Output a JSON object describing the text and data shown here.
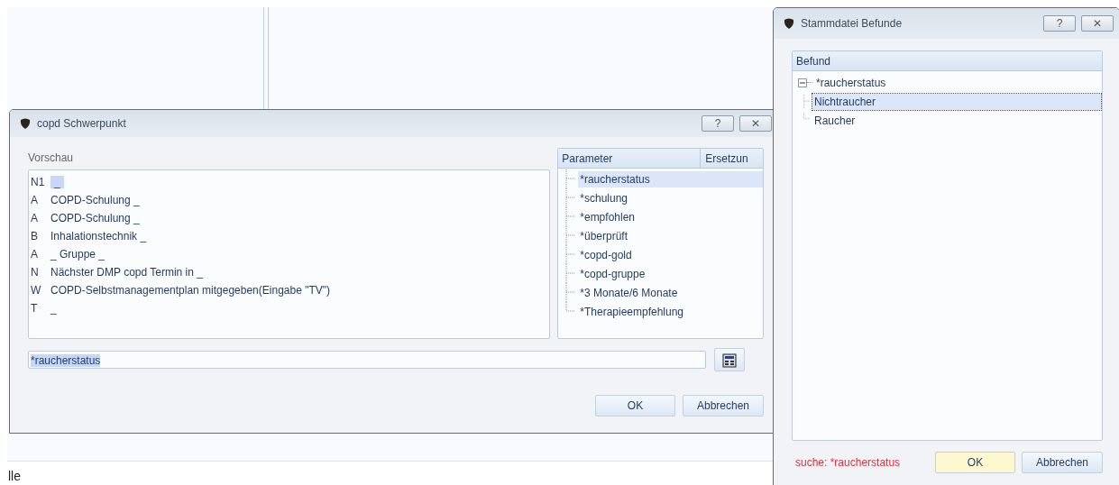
{
  "background": {
    "footer_text": "lle"
  },
  "preview_dialog": {
    "title": "copd Schwerpunkt",
    "help": "?",
    "close": "✕",
    "preview_label": "Vorschau",
    "lines": [
      {
        "code": "N1",
        "text": "_",
        "highlighted": true
      },
      {
        "code": "A",
        "text": "COPD-Schulung _",
        "highlighted": false
      },
      {
        "code": "A",
        "text": "COPD-Schulung _",
        "highlighted": false
      },
      {
        "code": "B",
        "text": "Inhalationstechnik _",
        "highlighted": false
      },
      {
        "code": "A",
        "text": "_ Gruppe _",
        "highlighted": false
      },
      {
        "code": "N",
        "text": "Nächster DMP copd Termin in _",
        "highlighted": false
      },
      {
        "code": "W",
        "text": "COPD-Selbstmanagementplan mitgegeben(Eingabe \"TV\")",
        "highlighted": false
      },
      {
        "code": "T",
        "text": "_",
        "highlighted": false
      }
    ],
    "parameter_columns": [
      "Parameter",
      "Ersetzun"
    ],
    "parameters": [
      {
        "label": "*raucherstatus",
        "selected": true
      },
      {
        "label": "*schulung",
        "selected": false
      },
      {
        "label": "*empfohlen",
        "selected": false
      },
      {
        "label": "*überprüft",
        "selected": false
      },
      {
        "label": "*copd-gold",
        "selected": false
      },
      {
        "label": "*copd-gruppe",
        "selected": false
      },
      {
        "label": "*3 Monate/6 Monate",
        "selected": false
      },
      {
        "label": "*Therapieempfehlung",
        "selected": false
      }
    ],
    "field": {
      "value": "*raucherstatus"
    },
    "buttons": [
      "OK",
      "Abbrechen"
    ]
  },
  "befunde_dialog": {
    "title": "Stammdatei Befunde",
    "help": "?",
    "close": "✕",
    "column": "Befund",
    "tree": [
      {
        "label": "*raucherstatus",
        "expanded": true,
        "selected": false,
        "children": [
          {
            "label": "Nichtraucher",
            "selected": true
          },
          {
            "label": "Raucher",
            "selected": false
          }
        ]
      }
    ],
    "search_text": "suche: *raucherstatus",
    "buttons": [
      {
        "label": "OK",
        "default": true
      },
      {
        "label": "Abbrechen",
        "default": false
      }
    ]
  }
}
